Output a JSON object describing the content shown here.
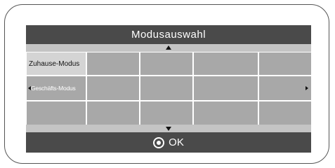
{
  "menu": {
    "title": "Modusauswahl",
    "rows": [
      {
        "label": "Zuhause-Modus",
        "selected": true,
        "has_left_arrow": false,
        "has_right_arrow": false
      },
      {
        "label": "Geschäfts-Modus",
        "selected": false,
        "has_left_arrow": true,
        "has_right_arrow": true
      },
      {
        "label": "",
        "selected": false,
        "has_left_arrow": false,
        "has_right_arrow": false
      }
    ],
    "columns_per_row": 5
  },
  "footer": {
    "ok_label": "OK",
    "ok_icon": "ok-circle-icon"
  },
  "scroll": {
    "up_icon": "triangle-up-icon",
    "down_icon": "triangle-down-icon"
  },
  "colors": {
    "title_bar": "#4a4a4a",
    "cell": "#a8a8a8",
    "selected_cell": "#d4d4d4",
    "grid_lines": "#ffffff"
  }
}
